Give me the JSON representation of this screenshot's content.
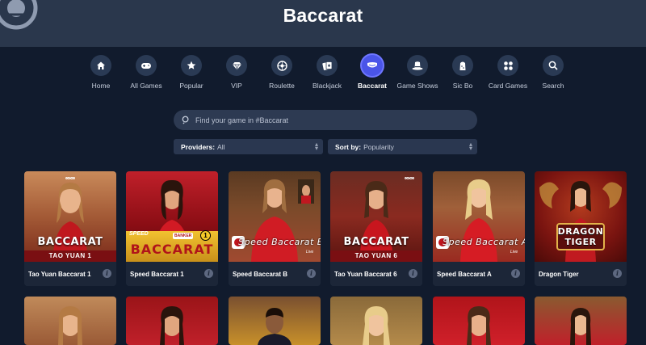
{
  "page": {
    "title": "Baccarat"
  },
  "categories": [
    {
      "label": "Home",
      "icon": "home-icon"
    },
    {
      "label": "All Games",
      "icon": "gamepad-icon"
    },
    {
      "label": "Popular",
      "icon": "star-icon"
    },
    {
      "label": "VIP",
      "icon": "diamond-icon"
    },
    {
      "label": "Roulette",
      "icon": "roulette-icon"
    },
    {
      "label": "Blackjack",
      "icon": "cards-icon"
    },
    {
      "label": "Baccarat",
      "icon": "baccarat-icon",
      "active": true
    },
    {
      "label": "Game Shows",
      "icon": "top-hat-icon"
    },
    {
      "label": "Sic Bo",
      "icon": "dice-cup-icon"
    },
    {
      "label": "Card Games",
      "icon": "suits-icon"
    },
    {
      "label": "Search",
      "icon": "search-icon"
    }
  ],
  "search": {
    "placeholder": "Find your game in #Baccarat"
  },
  "filters": {
    "providers_label": "Providers:",
    "providers_value": "All",
    "sort_label": "Sort by:",
    "sort_value": "Popularity"
  },
  "games": [
    {
      "name": "Tao Yuan Baccarat 1",
      "logo": "BACCARAT",
      "logo_sub": "TAO YUAN 1"
    },
    {
      "name": "Speed Baccarat 1",
      "logo": "BACCARAT",
      "logo_prefix": "SPEED",
      "logo_badge": "BANKER",
      "logo_num": "1"
    },
    {
      "name": "Speed Baccarat B",
      "logo": "Speed Baccarat B",
      "logo_live": "Live"
    },
    {
      "name": "Tao Yuan Baccarat 6",
      "logo": "BACCARAT",
      "logo_sub": "TAO YUAN 6"
    },
    {
      "name": "Speed Baccarat A",
      "logo": "Speed Baccarat A",
      "logo_live": "Live"
    },
    {
      "name": "Dragon Tiger",
      "logo": "DRAGON",
      "logo_2": "TIGER"
    }
  ],
  "colors": {
    "accent": "#4a55e8",
    "header": "#2a374c",
    "background": "#111b2d"
  }
}
